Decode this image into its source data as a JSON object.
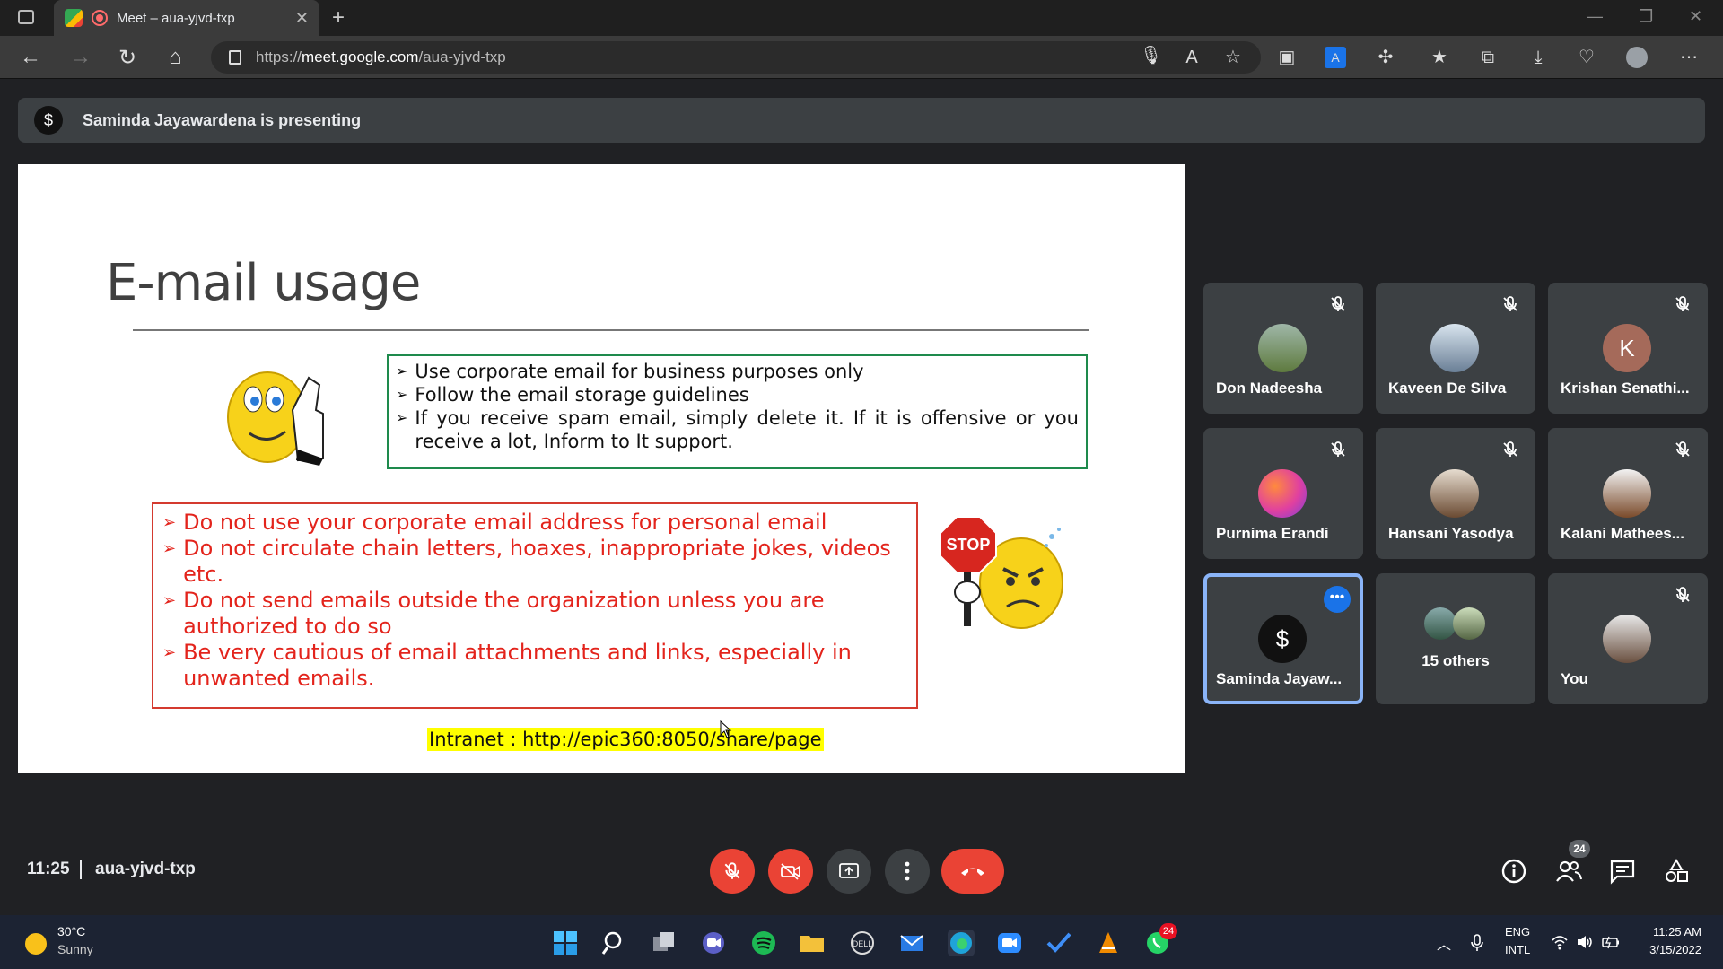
{
  "browser": {
    "tab_title": "Meet – aua-yjvd-txp",
    "url_prefix": "https://",
    "url_host": "meet.google.com",
    "url_path": "/aua-yjvd-txp"
  },
  "meet": {
    "presenting_text": "Saminda Jayawardena is presenting",
    "presenter_initial": "$",
    "time": "11:25",
    "meeting_code": "aua-yjvd-txp",
    "people_count": "24"
  },
  "slide": {
    "title": "E-mail usage",
    "good_items": [
      "Use corporate email for business purposes only",
      "Follow the email storage guidelines",
      "If you receive spam email, simply delete it.  If it is offensive or you receive a lot, Inform to It support."
    ],
    "bad_items": [
      "Do not use your corporate email address for personal email",
      "Do not circulate chain letters, hoaxes, inappropriate jokes, videos etc.",
      "Do not send emails outside the organization unless you are authorized to do so",
      "Be very cautious of email attachments and links, especially in unwanted emails."
    ],
    "intranet": "Intranet : http://epic360:8050/share/page",
    "stop_sign": "STOP"
  },
  "participants": [
    {
      "name": "Don Nadeesha",
      "color": "#6b8a4e",
      "initial": ""
    },
    {
      "name": "Kaveen De Silva",
      "color": "#b0c4d8",
      "initial": ""
    },
    {
      "name": "Krishan Senathi...",
      "color": "#a56a5a",
      "initial": "K"
    },
    {
      "name": "Purnima Erandi",
      "color": "#e040a0",
      "initial": ""
    },
    {
      "name": "Hansani Yasodya",
      "color": "#c8b8a8",
      "initial": ""
    },
    {
      "name": "Kalani Mathees...",
      "color": "#8a5a3a",
      "initial": ""
    },
    {
      "name": "Saminda Jayaw...",
      "color": "#111111",
      "initial": "$"
    },
    {
      "name": "15 others",
      "color": "#555",
      "initial": ""
    },
    {
      "name": "You",
      "color": "#9aa0a6",
      "initial": ""
    }
  ],
  "taskbar": {
    "temperature": "30°C",
    "condition": "Sunny",
    "lang1": "ENG",
    "lang2": "INTL",
    "clock_time": "11:25 AM",
    "clock_date": "3/15/2022",
    "whatsapp_badge": "24"
  }
}
